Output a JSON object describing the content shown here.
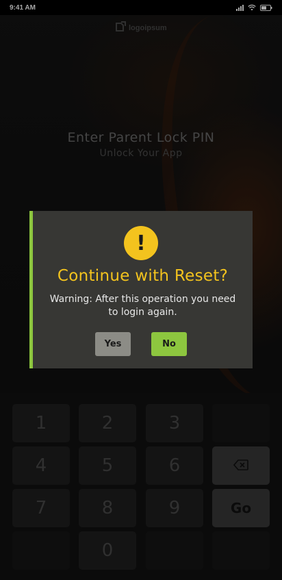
{
  "status_bar": {
    "time": "9:41 AM"
  },
  "logo": {
    "text": "logoipsum"
  },
  "screen": {
    "title": "Enter Parent Lock PIN",
    "subtitle": "Unlock Your App"
  },
  "keypad": {
    "keys": [
      "1",
      "2",
      "3",
      "4",
      "5",
      "6",
      "7",
      "8",
      "9",
      "0"
    ],
    "go_label": "Go",
    "backspace_icon": "backspace-icon"
  },
  "dialog": {
    "icon": "warning-icon",
    "icon_glyph": "!",
    "title": "Continue with Reset?",
    "message": "Warning: After this operation you need to login again.",
    "yes_label": "Yes",
    "no_label": "No"
  },
  "colors": {
    "accent_green": "#8dc63f",
    "warning_yellow": "#f3c31e",
    "dialog_bg": "#373734"
  }
}
